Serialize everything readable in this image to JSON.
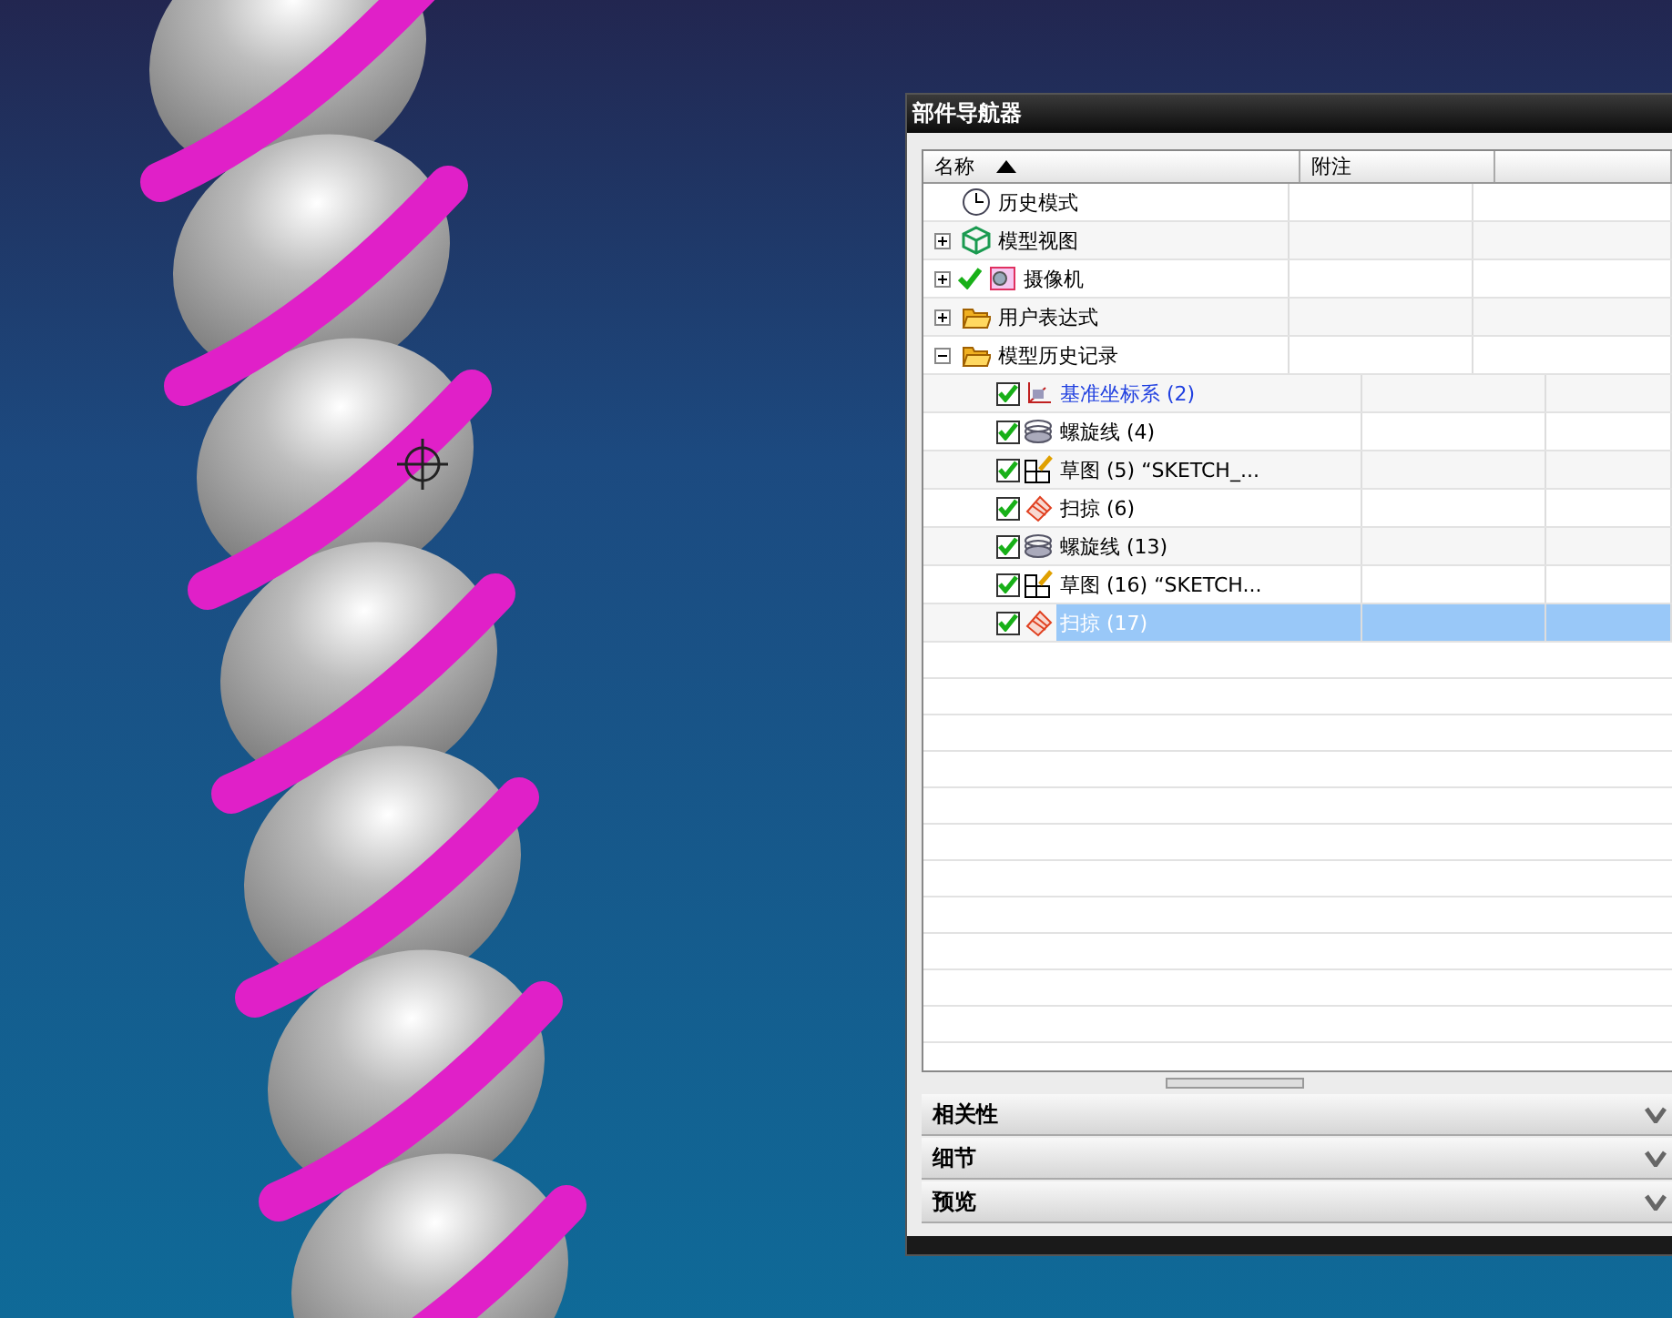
{
  "navigator": {
    "title": "部件导航器",
    "columns": [
      {
        "label": "名称",
        "sorted": true
      },
      {
        "label": "附注",
        "sorted": false
      }
    ],
    "items": [
      {
        "label": "历史模式",
        "kind": "clock",
        "checked": false
      },
      {
        "label": "模型视图",
        "kind": "view",
        "checked": false,
        "expanded": false
      },
      {
        "label": "摄像机",
        "kind": "camera",
        "checked": true,
        "expanded": false
      },
      {
        "label": "用户表达式",
        "kind": "folder",
        "checked": false,
        "expanded": false
      },
      {
        "label": "模型历史记录",
        "kind": "folder",
        "checked": false,
        "expanded": true,
        "children": [
          {
            "label": "基准坐标系 (2)",
            "kind": "datum",
            "checked": true,
            "emphasized": true,
            "selected": false
          },
          {
            "label": "螺旋线 (4)",
            "kind": "helix",
            "checked": true,
            "emphasized": false,
            "selected": false
          },
          {
            "label": "草图 (5) “SKETCH_...",
            "kind": "sketch",
            "checked": true,
            "emphasized": false,
            "selected": false
          },
          {
            "label": "扫掠 (6)",
            "kind": "sweep",
            "checked": true,
            "emphasized": false,
            "selected": false
          },
          {
            "label": "螺旋线 (13)",
            "kind": "helix",
            "checked": true,
            "emphasized": false,
            "selected": false
          },
          {
            "label": "草图 (16) “SKETCH...",
            "kind": "sketch",
            "checked": true,
            "emphasized": false,
            "selected": false
          },
          {
            "label": "扫掠 (17)",
            "kind": "sweep",
            "checked": true,
            "emphasized": false,
            "selected": true
          }
        ]
      }
    ]
  },
  "sections": [
    {
      "label": "相关性",
      "expanded": false
    },
    {
      "label": "细节",
      "expanded": false
    },
    {
      "label": "预览",
      "expanded": false
    }
  ]
}
